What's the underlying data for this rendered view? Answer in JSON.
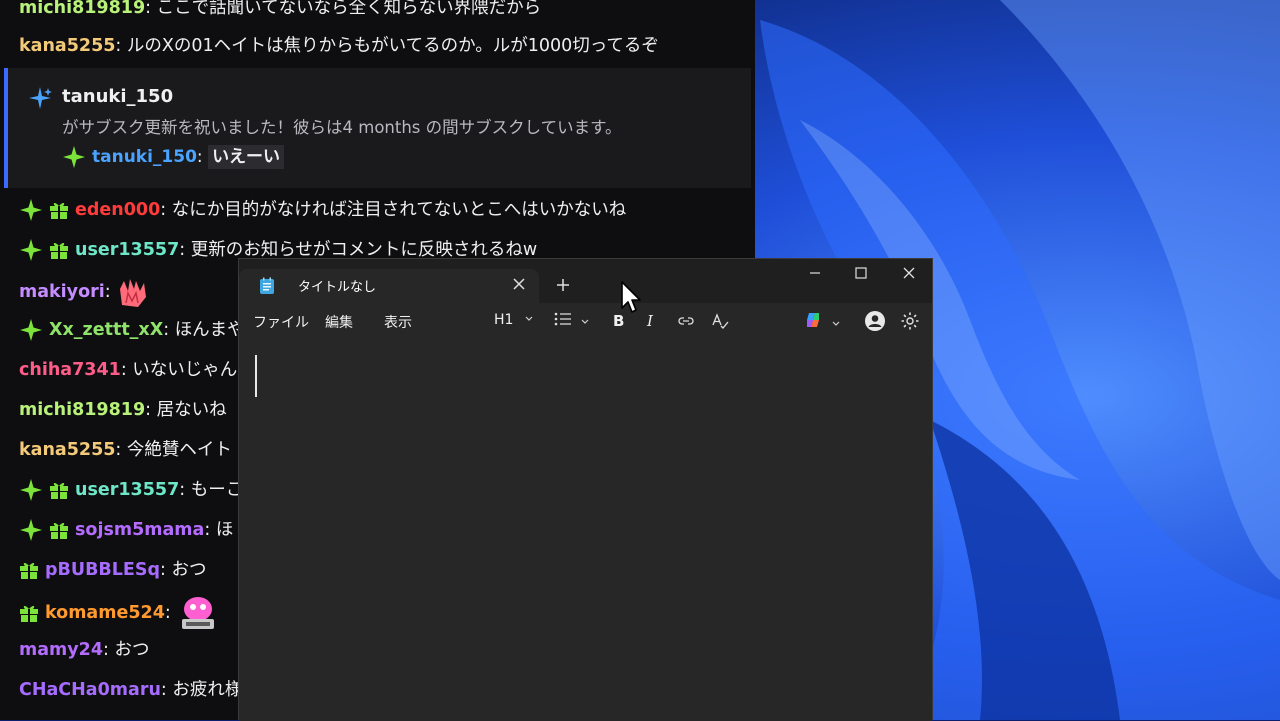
{
  "chat": {
    "lines": [
      {
        "user": "michi819819",
        "color": "#b9f27a",
        "text": "ここで話聞いてないなら全く知らない界隈だから",
        "badges": []
      },
      {
        "user": "kana5255",
        "color": "#f3c97a",
        "text": "ルのXの01ヘイトは焦りからもがいてるのか。ルが1000切ってるぞ",
        "badges": []
      },
      {
        "user": "eden000",
        "color": "#ff3b3b",
        "text": "なにか目的がなければ注目されてないとこへはいかないね",
        "badges": [
          "star",
          "gift"
        ]
      },
      {
        "user": "user13557",
        "color": "#6ee6c8",
        "text": "更新のお知らせがコメントに反映されるねw",
        "badges": [
          "star",
          "gift"
        ]
      },
      {
        "user": "makiyori",
        "color": "#c48cff",
        "text": "",
        "badges": [],
        "emote": "hands-emote"
      },
      {
        "user": "Xx_zettt_xX",
        "color": "#8fe36a",
        "text": "ほんまや",
        "badges": [
          "star"
        ]
      },
      {
        "user": "chiha7341",
        "color": "#ff5c8a",
        "text": "いないじゃん",
        "badges": []
      },
      {
        "user": "michi819819",
        "color": "#b9f27a",
        "text": "居ないね",
        "badges": []
      },
      {
        "user": "kana5255",
        "color": "#f3c97a",
        "text": "今絶賛ヘイト",
        "badges": []
      },
      {
        "user": "user13557",
        "color": "#6ee6c8",
        "text": "もーこ",
        "badges": [
          "star",
          "gift"
        ]
      },
      {
        "user": "sojsm5mama",
        "color": "#b46cff",
        "text": "ほ",
        "badges": [
          "star",
          "gift"
        ]
      },
      {
        "user": "pBUBBLESq",
        "color": "#a66bff",
        "text": "おつ",
        "badges": [
          "gift"
        ]
      },
      {
        "user": "komame524",
        "color": "#ff9a2e",
        "text": "",
        "badges": [
          "gift"
        ],
        "emote": "robot-emote"
      },
      {
        "user": "mamy24",
        "color": "#b46cff",
        "text": "おつ",
        "badges": []
      },
      {
        "user": "CHaCHa0maru",
        "color": "#a66bff",
        "text": "お疲れ様",
        "badges": []
      }
    ],
    "sub": {
      "user": "tanuki_150",
      "text": "がサブスク更新を祝いました！彼らは4 months の間サブスクしています。",
      "msg_user": "tanuki_150",
      "msg_text": "いえーい",
      "msg_user_color": "#4aa3ff"
    }
  },
  "notepad": {
    "tab_title": "タイトルなし",
    "menu": [
      "ファイル",
      "編集",
      "表示"
    ],
    "heading_label": "H1",
    "bold_label": "B",
    "italic_label": "I",
    "body_text": ""
  },
  "colors": {
    "chat_bg": "#0e0e10",
    "sub_accent": "#3b6cff",
    "notepad_bg": "#272727",
    "notepad_titlebar": "#1f1f1f"
  }
}
